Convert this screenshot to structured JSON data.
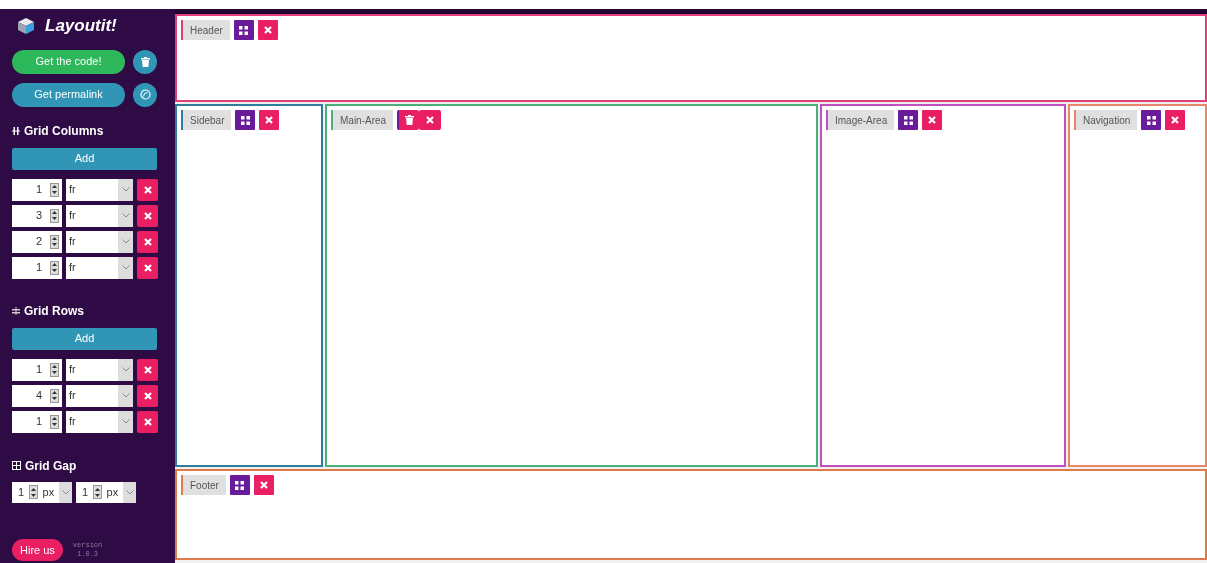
{
  "brand": {
    "name": "Layoutit!"
  },
  "actions": [
    {
      "label": "Get the code!",
      "kind": "code"
    },
    {
      "label": "Get permalink",
      "kind": "link"
    }
  ],
  "columns": {
    "title": "Grid Columns",
    "add": "Add",
    "tracks": [
      {
        "value": "1",
        "unit": "fr"
      },
      {
        "value": "3",
        "unit": "fr"
      },
      {
        "value": "2",
        "unit": "fr"
      },
      {
        "value": "1",
        "unit": "fr"
      }
    ]
  },
  "rows": {
    "title": "Grid Rows",
    "add": "Add",
    "tracks": [
      {
        "value": "1",
        "unit": "fr"
      },
      {
        "value": "4",
        "unit": "fr"
      },
      {
        "value": "1",
        "unit": "fr"
      }
    ]
  },
  "gap": {
    "title": "Grid Gap",
    "fields": [
      {
        "value": "1",
        "unit": "px"
      },
      {
        "value": "1",
        "unit": "px"
      }
    ]
  },
  "hire": "Hire us",
  "version": [
    "version",
    "1.0.3"
  ],
  "areas": [
    {
      "name": "Header",
      "color": "#e0407a",
      "kind": "grid-button"
    },
    {
      "name": "Sidebar",
      "color": "#2e7d9a",
      "kind": "grid-button"
    },
    {
      "name": "Main-Area",
      "color": "#4caf7a",
      "kind": "trash-button"
    },
    {
      "name": "Image-Area",
      "color": "#c050c0",
      "kind": "grid-button"
    },
    {
      "name": "Navigation",
      "color": "#e8866a",
      "kind": "grid-button"
    },
    {
      "name": "Footer",
      "color": "#e07a4a",
      "kind": "grid-button"
    }
  ]
}
